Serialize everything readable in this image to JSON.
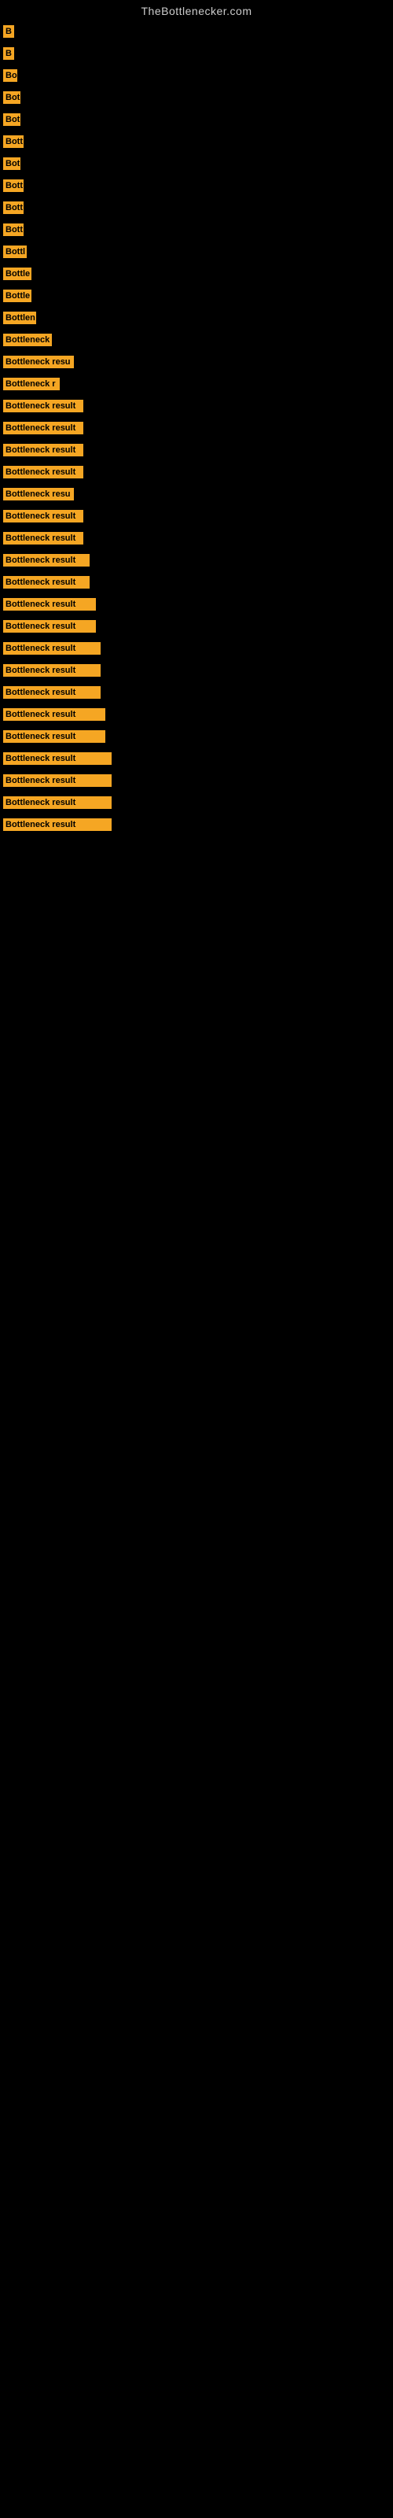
{
  "site_title": "TheBottlenecker.com",
  "bars": [
    {
      "label": "B",
      "width": 14
    },
    {
      "label": "B",
      "width": 14
    },
    {
      "label": "Bo",
      "width": 18
    },
    {
      "label": "Bot",
      "width": 22
    },
    {
      "label": "Bot",
      "width": 22
    },
    {
      "label": "Bott",
      "width": 26
    },
    {
      "label": "Bot",
      "width": 22
    },
    {
      "label": "Bott",
      "width": 26
    },
    {
      "label": "Bott",
      "width": 26
    },
    {
      "label": "Bott",
      "width": 26
    },
    {
      "label": "Bottl",
      "width": 30
    },
    {
      "label": "Bottle",
      "width": 36
    },
    {
      "label": "Bottle",
      "width": 36
    },
    {
      "label": "Bottlen",
      "width": 42
    },
    {
      "label": "Bottleneck",
      "width": 62
    },
    {
      "label": "Bottleneck resu",
      "width": 90
    },
    {
      "label": "Bottleneck r",
      "width": 72
    },
    {
      "label": "Bottleneck result",
      "width": 102
    },
    {
      "label": "Bottleneck result",
      "width": 102
    },
    {
      "label": "Bottleneck result",
      "width": 102
    },
    {
      "label": "Bottleneck result",
      "width": 102
    },
    {
      "label": "Bottleneck resu",
      "width": 90
    },
    {
      "label": "Bottleneck result",
      "width": 102
    },
    {
      "label": "Bottleneck result",
      "width": 102
    },
    {
      "label": "Bottleneck result",
      "width": 110
    },
    {
      "label": "Bottleneck result",
      "width": 110
    },
    {
      "label": "Bottleneck result",
      "width": 118
    },
    {
      "label": "Bottleneck result",
      "width": 118
    },
    {
      "label": "Bottleneck result",
      "width": 124
    },
    {
      "label": "Bottleneck result",
      "width": 124
    },
    {
      "label": "Bottleneck result",
      "width": 124
    },
    {
      "label": "Bottleneck result",
      "width": 130
    },
    {
      "label": "Bottleneck result",
      "width": 130
    },
    {
      "label": "Bottleneck result",
      "width": 138
    },
    {
      "label": "Bottleneck result",
      "width": 138
    },
    {
      "label": "Bottleneck result",
      "width": 138
    },
    {
      "label": "Bottleneck result",
      "width": 138
    }
  ]
}
